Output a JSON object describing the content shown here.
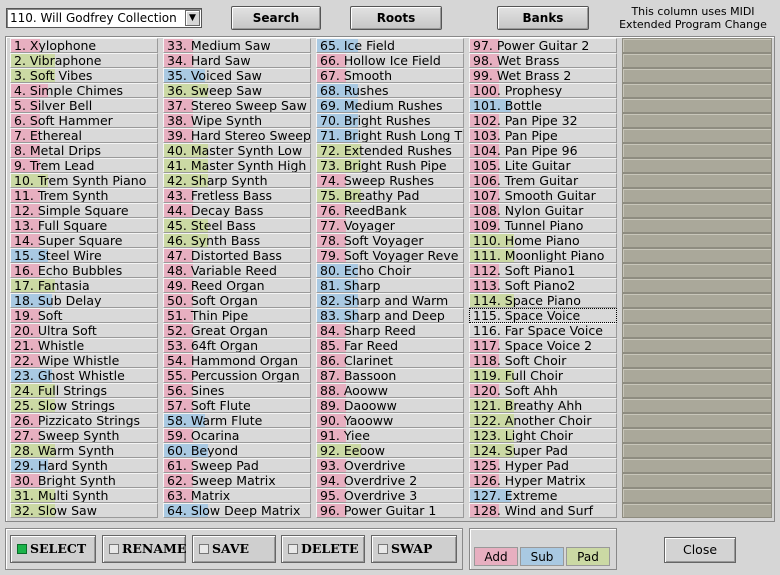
{
  "colors": {
    "add": "#e7afc0",
    "sub": "#a9c9e2",
    "pad": "#cbd9a4"
  },
  "collection": {
    "value": "110. Will Godfrey Collection"
  },
  "toolbar": {
    "search": "Search",
    "roots": "Roots",
    "banks": "Banks"
  },
  "note": {
    "line1": "This column uses MIDI",
    "line2": "Extended Program Change"
  },
  "programs": [
    {
      "label": "1. Xylophone",
      "kind": "add",
      "level": 0.2
    },
    {
      "label": "2. Vibraphone",
      "kind": "pad",
      "level": 0.3
    },
    {
      "label": "3. Soft Vibes",
      "kind": "pad",
      "level": 0.3
    },
    {
      "label": "4. Simple Chimes",
      "kind": "add",
      "level": 0.25
    },
    {
      "label": "5. Silver Bell",
      "kind": "add",
      "level": 0.2
    },
    {
      "label": "6. Soft Hammer",
      "kind": "add",
      "level": 0.2
    },
    {
      "label": "7. Ethereal",
      "kind": "add",
      "level": 0.2
    },
    {
      "label": "8. Metal Drips",
      "kind": "add",
      "level": 0.2
    },
    {
      "label": "9. Trem Lead",
      "kind": "add",
      "level": 0.2
    },
    {
      "label": "10. Trem Synth Piano",
      "kind": "pad",
      "level": 0.25
    },
    {
      "label": "11. Trem Synth",
      "kind": "add",
      "level": 0.2
    },
    {
      "label": "12. Simple Square",
      "kind": "add",
      "level": 0.2
    },
    {
      "label": "13. Full Square",
      "kind": "add",
      "level": 0.2
    },
    {
      "label": "14. Super Square",
      "kind": "add",
      "level": 0.2
    },
    {
      "label": "15. Steel Wire",
      "kind": "sub",
      "level": 0.25
    },
    {
      "label": "16. Echo Bubbles",
      "kind": "add",
      "level": 0.2
    },
    {
      "label": "17. Fantasia",
      "kind": "pad",
      "level": 0.3
    },
    {
      "label": "18. Sub Delay",
      "kind": "sub",
      "level": 0.28
    },
    {
      "label": "19. Soft",
      "kind": "add",
      "level": 0.2
    },
    {
      "label": "20. Ultra Soft",
      "kind": "add",
      "level": 0.2
    },
    {
      "label": "21. Whistle",
      "kind": "add",
      "level": 0.2
    },
    {
      "label": "22. Wipe Whistle",
      "kind": "add",
      "level": 0.2
    },
    {
      "label": "23. Ghost Whistle",
      "kind": "sub",
      "level": 0.28
    },
    {
      "label": "24. Full Strings",
      "kind": "pad",
      "level": 0.3
    },
    {
      "label": "25. Slow Strings",
      "kind": "pad",
      "level": 0.3
    },
    {
      "label": "26. Pizzicato Strings",
      "kind": "add",
      "level": 0.2
    },
    {
      "label": "27. Sweep Synth",
      "kind": "add",
      "level": 0.2
    },
    {
      "label": "28. Warm Synth",
      "kind": "pad",
      "level": 0.3
    },
    {
      "label": "29. Hard Synth",
      "kind": "sub",
      "level": 0.25
    },
    {
      "label": "30. Bright Synth",
      "kind": "add",
      "level": 0.2
    },
    {
      "label": "31. Multi Synth",
      "kind": "pad",
      "level": 0.3
    },
    {
      "label": "32. Slow Saw",
      "kind": "pad",
      "level": 0.3
    },
    {
      "label": "33. Medium Saw",
      "kind": "add",
      "level": 0.2
    },
    {
      "label": "34. Hard Saw",
      "kind": "add",
      "level": 0.2
    },
    {
      "label": "35. Voiced Saw",
      "kind": "sub",
      "level": 0.28
    },
    {
      "label": "36. Sweep Saw",
      "kind": "pad",
      "level": 0.3
    },
    {
      "label": "37. Stereo Sweep Saw",
      "kind": "add",
      "level": 0.2
    },
    {
      "label": "38. Wipe Synth",
      "kind": "add",
      "level": 0.2
    },
    {
      "label": "39. Hard Stereo Sweep",
      "kind": "add",
      "level": 0.2
    },
    {
      "label": "40. Master Synth Low",
      "kind": "pad",
      "level": 0.3
    },
    {
      "label": "41. Master Synth High",
      "kind": "pad",
      "level": 0.3
    },
    {
      "label": "42. Sharp Synth",
      "kind": "pad",
      "level": 0.3
    },
    {
      "label": "43. Fretless Bass",
      "kind": "add",
      "level": 0.2
    },
    {
      "label": "44. Decay Bass",
      "kind": "add",
      "level": 0.2
    },
    {
      "label": "45. Steel Bass",
      "kind": "pad",
      "level": 0.3
    },
    {
      "label": "46. Synth Bass",
      "kind": "pad",
      "level": 0.3
    },
    {
      "label": "47. Distorted Bass",
      "kind": "add",
      "level": 0.2
    },
    {
      "label": "48. Variable Reed",
      "kind": "add",
      "level": 0.2
    },
    {
      "label": "49. Reed Organ",
      "kind": "add",
      "level": 0.2
    },
    {
      "label": "50. Soft Organ",
      "kind": "add",
      "level": 0.2
    },
    {
      "label": "51. Thin Pipe",
      "kind": "add",
      "level": 0.2
    },
    {
      "label": "52. Great Organ",
      "kind": "add",
      "level": 0.2
    },
    {
      "label": "53. 64ft Organ",
      "kind": "add",
      "level": 0.2
    },
    {
      "label": "54. Hammond Organ",
      "kind": "add",
      "level": 0.2
    },
    {
      "label": "55. Percussion Organ",
      "kind": "add",
      "level": 0.2
    },
    {
      "label": "56. Sines",
      "kind": "add",
      "level": 0.2
    },
    {
      "label": "57. Soft Flute",
      "kind": "add",
      "level": 0.2
    },
    {
      "label": "58. Warm Flute",
      "kind": "sub",
      "level": 0.28
    },
    {
      "label": "59. Ocarina",
      "kind": "add",
      "level": 0.2
    },
    {
      "label": "60. Beyond",
      "kind": "sub",
      "level": 0.3
    },
    {
      "label": "61. Sweep Pad",
      "kind": "add",
      "level": 0.2
    },
    {
      "label": "62. Sweep Matrix",
      "kind": "add",
      "level": 0.2
    },
    {
      "label": "63. Matrix",
      "kind": "add",
      "level": 0.2
    },
    {
      "label": "64. Slow Deep Matrix",
      "kind": "sub",
      "level": 0.3
    },
    {
      "label": "65. Ice Field",
      "kind": "sub",
      "level": 0.28
    },
    {
      "label": "66. Hollow Ice Field",
      "kind": "add",
      "level": 0.2
    },
    {
      "label": "67. Smooth",
      "kind": "add",
      "level": 0.2
    },
    {
      "label": "68. Rushes",
      "kind": "sub",
      "level": 0.28
    },
    {
      "label": "69. Medium Rushes",
      "kind": "sub",
      "level": 0.28
    },
    {
      "label": "70. Bright Rushes",
      "kind": "sub",
      "level": 0.28
    },
    {
      "label": "71. Bright Rush Long T",
      "kind": "sub",
      "level": 0.28
    },
    {
      "label": "72. Extended Rushes",
      "kind": "pad",
      "level": 0.3
    },
    {
      "label": "73. Bright Rush Pipe",
      "kind": "pad",
      "level": 0.3
    },
    {
      "label": "74. Sweep Rushes",
      "kind": "add",
      "level": 0.2
    },
    {
      "label": "75. Breathy Pad",
      "kind": "pad",
      "level": 0.3
    },
    {
      "label": "76. ReedBank",
      "kind": "add",
      "level": 0.2
    },
    {
      "label": "77. Voyager",
      "kind": "add",
      "level": 0.2
    },
    {
      "label": "78. Soft Voyager",
      "kind": "add",
      "level": 0.2
    },
    {
      "label": "79. Soft Voyager Reve",
      "kind": "add",
      "level": 0.2
    },
    {
      "label": "80. Echo Choir",
      "kind": "sub",
      "level": 0.28
    },
    {
      "label": "81. Sharp",
      "kind": "sub",
      "level": 0.28
    },
    {
      "label": "82. Sharp and Warm",
      "kind": "sub",
      "level": 0.28
    },
    {
      "label": "83. Sharp and Deep",
      "kind": "sub",
      "level": 0.28
    },
    {
      "label": "84. Sharp Reed",
      "kind": "add",
      "level": 0.2
    },
    {
      "label": "85. Far Reed",
      "kind": "add",
      "level": 0.2
    },
    {
      "label": "86. Clarinet",
      "kind": "add",
      "level": 0.2
    },
    {
      "label": "87. Bassoon",
      "kind": "add",
      "level": 0.2
    },
    {
      "label": "88. Aooww",
      "kind": "add",
      "level": 0.2
    },
    {
      "label": "89. Daooww",
      "kind": "add",
      "level": 0.2
    },
    {
      "label": "90. Yaooww",
      "kind": "add",
      "level": 0.2
    },
    {
      "label": "91. Yiee",
      "kind": "add",
      "level": 0.2
    },
    {
      "label": "92. Eeoow",
      "kind": "pad",
      "level": 0.3
    },
    {
      "label": "93. Overdrive",
      "kind": "add",
      "level": 0.2
    },
    {
      "label": "94. Overdrive 2",
      "kind": "add",
      "level": 0.2
    },
    {
      "label": "95. Overdrive 3",
      "kind": "add",
      "level": 0.2
    },
    {
      "label": "96. Power Guitar 1",
      "kind": "add",
      "level": 0.2
    },
    {
      "label": "97. Power Guitar 2",
      "kind": "add",
      "level": 0.2
    },
    {
      "label": "98. Wet Brass",
      "kind": "add",
      "level": 0.2
    },
    {
      "label": "99. Wet Brass 2",
      "kind": "add",
      "level": 0.2
    },
    {
      "label": "100. Prophesy",
      "kind": "add",
      "level": 0.2
    },
    {
      "label": "101. Bottle",
      "kind": "sub",
      "level": 0.28
    },
    {
      "label": "102. Pan Pipe 32",
      "kind": "add",
      "level": 0.2
    },
    {
      "label": "103. Pan Pipe",
      "kind": "add",
      "level": 0.2
    },
    {
      "label": "104. Pan Pipe 96",
      "kind": "add",
      "level": 0.2
    },
    {
      "label": "105. Lite Guitar",
      "kind": "add",
      "level": 0.2
    },
    {
      "label": "106. Trem Guitar",
      "kind": "add",
      "level": 0.2
    },
    {
      "label": "107. Smooth Guitar",
      "kind": "add",
      "level": 0.2
    },
    {
      "label": "108. Nylon Guitar",
      "kind": "add",
      "level": 0.2
    },
    {
      "label": "109. Tunnel Piano",
      "kind": "add",
      "level": 0.2
    },
    {
      "label": "110. Home Piano",
      "kind": "pad",
      "level": 0.3
    },
    {
      "label": "111. Moonlight Piano",
      "kind": "pad",
      "level": 0.3
    },
    {
      "label": "112. Soft Piano1",
      "kind": "add",
      "level": 0.2
    },
    {
      "label": "113. Soft Piano2",
      "kind": "add",
      "level": 0.2
    },
    {
      "label": "114. Space Piano",
      "kind": "pad",
      "level": 0.3
    },
    {
      "label": "115. Space Voice",
      "kind": "none",
      "level": 0,
      "selected": true
    },
    {
      "label": "116. Far Space Voice",
      "kind": "none",
      "level": 0
    },
    {
      "label": "117. Space Voice 2",
      "kind": "add",
      "level": 0.2
    },
    {
      "label": "118. Soft Choir",
      "kind": "add",
      "level": 0.2
    },
    {
      "label": "119. Full Choir",
      "kind": "pad",
      "level": 0.3
    },
    {
      "label": "120. Soft Ahh",
      "kind": "add",
      "level": 0.2
    },
    {
      "label": "121. Breathy Ahh",
      "kind": "pad",
      "level": 0.3
    },
    {
      "label": "122. Another Choir",
      "kind": "pad",
      "level": 0.3
    },
    {
      "label": "123. Light Choir",
      "kind": "pad",
      "level": 0.3
    },
    {
      "label": "124. Super Pad",
      "kind": "pad",
      "level": 0.3
    },
    {
      "label": "125. Hyper Pad",
      "kind": "add",
      "level": 0.2
    },
    {
      "label": "126. Hyper Matrix",
      "kind": "add",
      "level": 0.2
    },
    {
      "label": "127. Extreme",
      "kind": "sub",
      "level": 0.28
    },
    {
      "label": "128. Wind and Surf",
      "kind": "add",
      "level": 0.2
    }
  ],
  "modes": [
    {
      "label": "SELECT",
      "active": true
    },
    {
      "label": "RENAME",
      "active": false
    },
    {
      "label": "SAVE",
      "active": false
    },
    {
      "label": "DELETE",
      "active": false
    },
    {
      "label": "SWAP",
      "active": false
    }
  ],
  "legend": {
    "add": "Add",
    "sub": "Sub",
    "pad": "Pad"
  },
  "close_label": "Close"
}
